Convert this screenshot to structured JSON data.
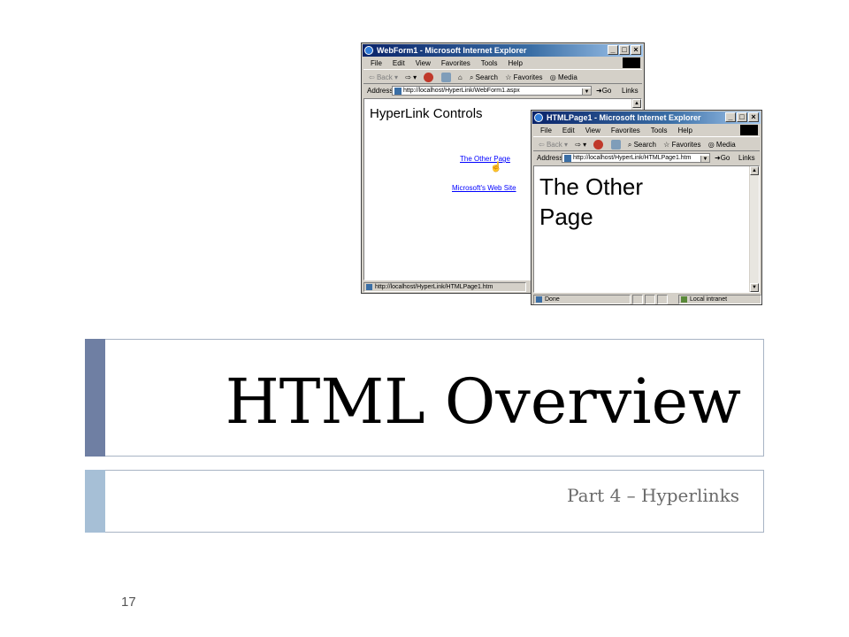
{
  "window1": {
    "title": "WebForm1 - Microsoft Internet Explorer",
    "menu": [
      "File",
      "Edit",
      "View",
      "Favorites",
      "Tools",
      "Help"
    ],
    "toolbar": {
      "back": "Back",
      "search": "Search",
      "favorites": "Favorites",
      "media": "Media"
    },
    "address_label": "Address",
    "address_value": "http://localhost/HyperLink/WebForm1.aspx",
    "go_label": "Go",
    "links_label": "Links",
    "heading": "HyperLink Controls",
    "link1": "The Other Page",
    "link2": "Microsoft's Web Site",
    "status": "http://localhost/HyperLink/HTMLPage1.htm"
  },
  "window2": {
    "title": "HTMLPage1 - Microsoft Internet Explorer",
    "menu": [
      "File",
      "Edit",
      "View",
      "Favorites",
      "Tools",
      "Help"
    ],
    "toolbar": {
      "back": "Back",
      "search": "Search",
      "favorites": "Favorites",
      "media": "Media"
    },
    "address_label": "Address",
    "address_value": "http://localhost/HyperLink/HTMLPage1.htm",
    "go_label": "Go",
    "links_label": "Links",
    "heading_line1": "The Other",
    "heading_line2": "Page",
    "status": "Done",
    "zone": "Local intranet"
  },
  "slide": {
    "title": "HTML Overview",
    "subtitle": "Part 4 – Hyperlinks",
    "page_number": "17"
  },
  "colors": {
    "title_accent": "#6f7fa3",
    "subtitle_accent": "#a6bfd6",
    "ie_titlebar": "#0a246a",
    "link": "#0000ff"
  }
}
